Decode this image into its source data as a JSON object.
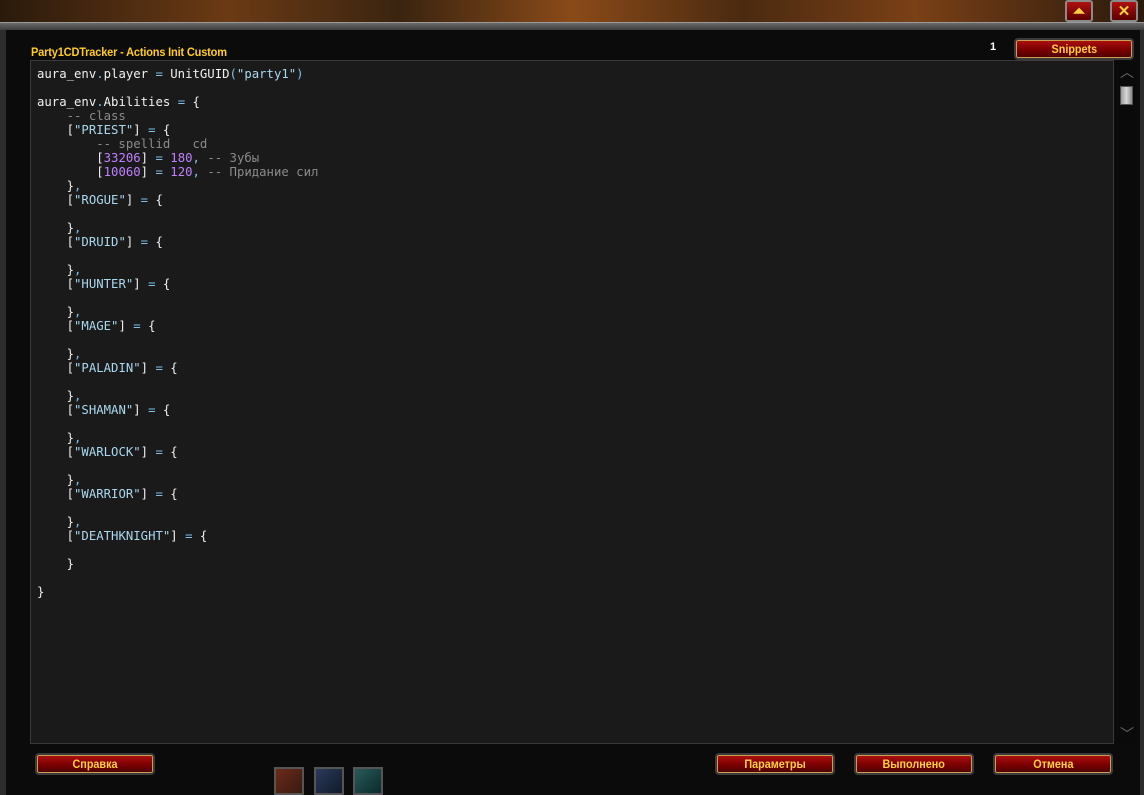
{
  "window": {
    "title": "Party1CDTracker - Actions Init Custom",
    "counter": "1",
    "snippets_label": "Snippets"
  },
  "corner_buttons": {
    "collapse_glyph": "⏶",
    "close_glyph": "✕"
  },
  "editor": {
    "lines": [
      [
        [
          "id",
          "aura_env"
        ],
        [
          "op",
          "."
        ],
        [
          "id",
          "player"
        ],
        [
          "id",
          " "
        ],
        [
          "op",
          "="
        ],
        [
          "id",
          " UnitGUID"
        ],
        [
          "op",
          "("
        ],
        [
          "str",
          "\"party1\""
        ],
        [
          "op",
          ")"
        ]
      ],
      [],
      [
        [
          "id",
          "aura_env"
        ],
        [
          "op",
          "."
        ],
        [
          "id",
          "Abilities"
        ],
        [
          "id",
          " "
        ],
        [
          "op",
          "="
        ],
        [
          "id",
          " "
        ],
        [
          "br",
          "{"
        ]
      ],
      [
        [
          "com",
          "    -- class"
        ]
      ],
      [
        [
          "id",
          "    "
        ],
        [
          "br",
          "["
        ],
        [
          "str",
          "\"PRIEST\""
        ],
        [
          "br",
          "]"
        ],
        [
          "id",
          " "
        ],
        [
          "op",
          "="
        ],
        [
          "id",
          " "
        ],
        [
          "br",
          "{"
        ]
      ],
      [
        [
          "com",
          "        -- spellid   cd"
        ]
      ],
      [
        [
          "id",
          "        "
        ],
        [
          "br",
          "["
        ],
        [
          "num",
          "33206"
        ],
        [
          "br",
          "]"
        ],
        [
          "id",
          " "
        ],
        [
          "op",
          "="
        ],
        [
          "id",
          " "
        ],
        [
          "num",
          "180"
        ],
        [
          "op",
          ","
        ],
        [
          "com",
          " -- Зубы"
        ]
      ],
      [
        [
          "id",
          "        "
        ],
        [
          "br",
          "["
        ],
        [
          "num",
          "10060"
        ],
        [
          "br",
          "]"
        ],
        [
          "id",
          " "
        ],
        [
          "op",
          "="
        ],
        [
          "id",
          " "
        ],
        [
          "num",
          "120"
        ],
        [
          "op",
          ","
        ],
        [
          "com",
          " -- Придание сил"
        ]
      ],
      [
        [
          "id",
          "    "
        ],
        [
          "br",
          "}"
        ],
        [
          "op",
          ","
        ]
      ],
      [
        [
          "id",
          "    "
        ],
        [
          "br",
          "["
        ],
        [
          "str",
          "\"ROGUE\""
        ],
        [
          "br",
          "]"
        ],
        [
          "id",
          " "
        ],
        [
          "op",
          "="
        ],
        [
          "id",
          " "
        ],
        [
          "br",
          "{"
        ]
      ],
      [],
      [
        [
          "id",
          "    "
        ],
        [
          "br",
          "}"
        ],
        [
          "op",
          ","
        ]
      ],
      [
        [
          "id",
          "    "
        ],
        [
          "br",
          "["
        ],
        [
          "str",
          "\"DRUID\""
        ],
        [
          "br",
          "]"
        ],
        [
          "id",
          " "
        ],
        [
          "op",
          "="
        ],
        [
          "id",
          " "
        ],
        [
          "br",
          "{"
        ]
      ],
      [],
      [
        [
          "id",
          "    "
        ],
        [
          "br",
          "}"
        ],
        [
          "op",
          ","
        ]
      ],
      [
        [
          "id",
          "    "
        ],
        [
          "br",
          "["
        ],
        [
          "str",
          "\"HUNTER\""
        ],
        [
          "br",
          "]"
        ],
        [
          "id",
          " "
        ],
        [
          "op",
          "="
        ],
        [
          "id",
          " "
        ],
        [
          "br",
          "{"
        ]
      ],
      [],
      [
        [
          "id",
          "    "
        ],
        [
          "br",
          "}"
        ],
        [
          "op",
          ","
        ]
      ],
      [
        [
          "id",
          "    "
        ],
        [
          "br",
          "["
        ],
        [
          "str",
          "\"MAGE\""
        ],
        [
          "br",
          "]"
        ],
        [
          "id",
          " "
        ],
        [
          "op",
          "="
        ],
        [
          "id",
          " "
        ],
        [
          "br",
          "{"
        ]
      ],
      [],
      [
        [
          "id",
          "    "
        ],
        [
          "br",
          "}"
        ],
        [
          "op",
          ","
        ]
      ],
      [
        [
          "id",
          "    "
        ],
        [
          "br",
          "["
        ],
        [
          "str",
          "\"PALADIN\""
        ],
        [
          "br",
          "]"
        ],
        [
          "id",
          " "
        ],
        [
          "op",
          "="
        ],
        [
          "id",
          " "
        ],
        [
          "br",
          "{"
        ]
      ],
      [],
      [
        [
          "id",
          "    "
        ],
        [
          "br",
          "}"
        ],
        [
          "op",
          ","
        ]
      ],
      [
        [
          "id",
          "    "
        ],
        [
          "br",
          "["
        ],
        [
          "str",
          "\"SHAMAN\""
        ],
        [
          "br",
          "]"
        ],
        [
          "id",
          " "
        ],
        [
          "op",
          "="
        ],
        [
          "id",
          " "
        ],
        [
          "br",
          "{"
        ]
      ],
      [],
      [
        [
          "id",
          "    "
        ],
        [
          "br",
          "}"
        ],
        [
          "op",
          ","
        ]
      ],
      [
        [
          "id",
          "    "
        ],
        [
          "br",
          "["
        ],
        [
          "str",
          "\"WARLOCK\""
        ],
        [
          "br",
          "]"
        ],
        [
          "id",
          " "
        ],
        [
          "op",
          "="
        ],
        [
          "id",
          " "
        ],
        [
          "br",
          "{"
        ]
      ],
      [],
      [
        [
          "id",
          "    "
        ],
        [
          "br",
          "}"
        ],
        [
          "op",
          ","
        ]
      ],
      [
        [
          "id",
          "    "
        ],
        [
          "br",
          "["
        ],
        [
          "str",
          "\"WARRIOR\""
        ],
        [
          "br",
          "]"
        ],
        [
          "id",
          " "
        ],
        [
          "op",
          "="
        ],
        [
          "id",
          " "
        ],
        [
          "br",
          "{"
        ]
      ],
      [],
      [
        [
          "id",
          "    "
        ],
        [
          "br",
          "}"
        ],
        [
          "op",
          ","
        ]
      ],
      [
        [
          "id",
          "    "
        ],
        [
          "br",
          "["
        ],
        [
          "str",
          "\"DEATHKNIGHT\""
        ],
        [
          "br",
          "]"
        ],
        [
          "id",
          " "
        ],
        [
          "op",
          "="
        ],
        [
          "id",
          " "
        ],
        [
          "br",
          "{"
        ]
      ],
      [],
      [
        [
          "id",
          "    "
        ],
        [
          "br",
          "}"
        ]
      ],
      [],
      [
        [
          "br",
          "}"
        ]
      ]
    ]
  },
  "scrollbar": {
    "up_glyph": "︿",
    "down_glyph": "﹀"
  },
  "footer": {
    "help_label": "Справка",
    "params_label": "Параметры",
    "done_label": "Выполнено",
    "cancel_label": "Отмена"
  },
  "colors": {
    "title": "#ffcc22",
    "button_text": "#ffd040",
    "string": "#aad8ee",
    "number": "#c080ff",
    "comment": "#8a8a8a"
  }
}
